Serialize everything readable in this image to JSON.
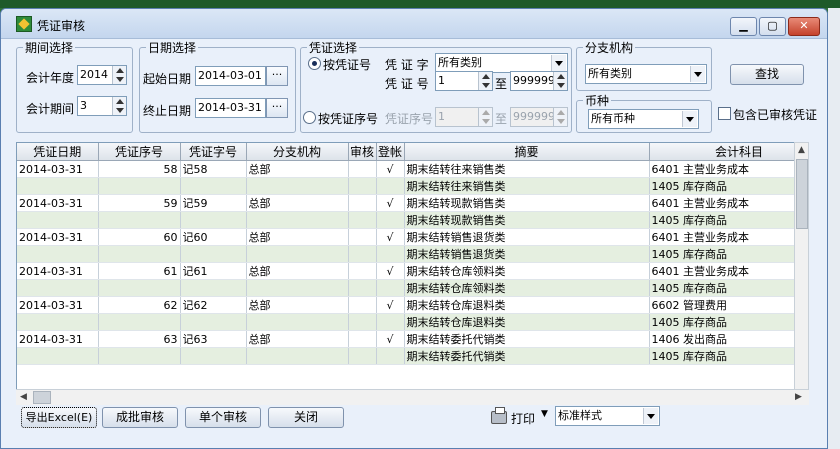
{
  "window": {
    "title": "凭证审核"
  },
  "period": {
    "group_title": "期间选择",
    "year_label": "会计年度",
    "year_value": "2014",
    "period_label": "会计期间",
    "period_value": "3"
  },
  "date": {
    "group_title": "日期选择",
    "start_label": "起始日期",
    "start_value": "2014-03-01",
    "end_label": "终止日期",
    "end_value": "2014-03-31",
    "pick_label": "···"
  },
  "voucher": {
    "group_title": "凭证选择",
    "by_number_label": "按凭证号",
    "type_label": "凭 证 字",
    "type_value": "所有类别",
    "number_label": "凭 证 号",
    "number_from": "1",
    "to_label": "至",
    "number_to": "999999",
    "by_seq_label": "按凭证序号",
    "seq_label": "凭证序号",
    "seq_from": "1",
    "seq_to": "999999"
  },
  "branch": {
    "group_title": "分支机构",
    "value": "所有类别"
  },
  "currency": {
    "group_title": "币种",
    "value": "所有币种"
  },
  "search_label": "查找",
  "include_audited_label": "包含已审核凭证",
  "table": {
    "headers": [
      "凭证日期",
      "凭证序号",
      "凭证字号",
      "分支机构",
      "审核",
      "登帐",
      "摘要",
      "会计科目"
    ],
    "rows": [
      {
        "date": "2014-03-31",
        "seq": "58",
        "num": "记58",
        "branch": "总部",
        "audit": "",
        "post": "√",
        "summary": "期末结转往来销售类",
        "account": "6401 主营业务成本"
      },
      {
        "date": "",
        "seq": "",
        "num": "",
        "branch": "",
        "audit": "",
        "post": "",
        "summary": "期末结转往来销售类",
        "account": "1405 库存商品"
      },
      {
        "date": "2014-03-31",
        "seq": "59",
        "num": "记59",
        "branch": "总部",
        "audit": "",
        "post": "√",
        "summary": "期末结转现款销售类",
        "account": "6401 主营业务成本"
      },
      {
        "date": "",
        "seq": "",
        "num": "",
        "branch": "",
        "audit": "",
        "post": "",
        "summary": "期末结转现款销售类",
        "account": "1405 库存商品"
      },
      {
        "date": "2014-03-31",
        "seq": "60",
        "num": "记60",
        "branch": "总部",
        "audit": "",
        "post": "√",
        "summary": "期末结转销售退货类",
        "account": "6401 主营业务成本"
      },
      {
        "date": "",
        "seq": "",
        "num": "",
        "branch": "",
        "audit": "",
        "post": "",
        "summary": "期末结转销售退货类",
        "account": "1405 库存商品"
      },
      {
        "date": "2014-03-31",
        "seq": "61",
        "num": "记61",
        "branch": "总部",
        "audit": "",
        "post": "√",
        "summary": "期末结转仓库领料类",
        "account": "6401 主营业务成本"
      },
      {
        "date": "",
        "seq": "",
        "num": "",
        "branch": "",
        "audit": "",
        "post": "",
        "summary": "期末结转仓库领料类",
        "account": "1405 库存商品"
      },
      {
        "date": "2014-03-31",
        "seq": "62",
        "num": "记62",
        "branch": "总部",
        "audit": "",
        "post": "√",
        "summary": "期末结转仓库退料类",
        "account": "6602 管理费用"
      },
      {
        "date": "",
        "seq": "",
        "num": "",
        "branch": "",
        "audit": "",
        "post": "",
        "summary": "期末结转仓库退料类",
        "account": "1405 库存商品"
      },
      {
        "date": "2014-03-31",
        "seq": "63",
        "num": "记63",
        "branch": "总部",
        "audit": "",
        "post": "√",
        "summary": "期末结转委托代销类",
        "account": "1406 发出商品"
      },
      {
        "date": "",
        "seq": "",
        "num": "",
        "branch": "",
        "audit": "",
        "post": "",
        "summary": "期末结转委托代销类",
        "account": "1405 库存商品"
      }
    ]
  },
  "footer": {
    "export_label": "导出Excel(E)",
    "batch_label": "成批审核",
    "single_label": "单个审核",
    "close_label": "关闭",
    "print_label": "打印",
    "style_value": "标准样式"
  }
}
